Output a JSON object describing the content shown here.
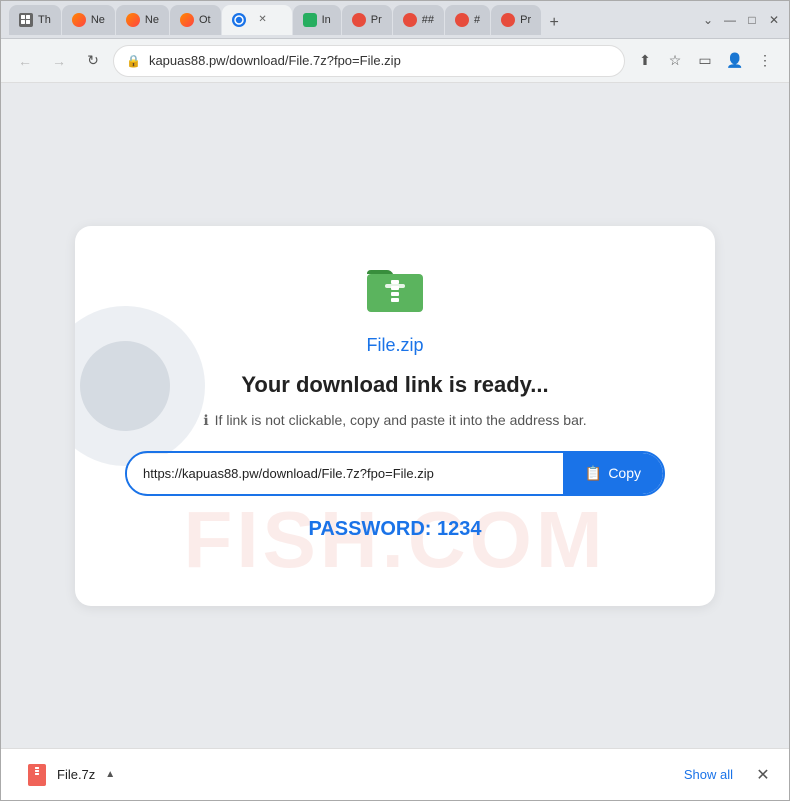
{
  "browser": {
    "tabs": [
      {
        "id": "tab1",
        "label": "Th",
        "active": false
      },
      {
        "id": "tab2",
        "label": "Ne",
        "active": false
      },
      {
        "id": "tab3",
        "label": "Ne",
        "active": false
      },
      {
        "id": "tab4",
        "label": "Ot",
        "active": false
      },
      {
        "id": "tab5",
        "label": "",
        "active": true,
        "url": ""
      },
      {
        "id": "tab6",
        "label": "In",
        "active": false
      },
      {
        "id": "tab7",
        "label": "Pr",
        "active": false
      },
      {
        "id": "tab8",
        "label": "##",
        "active": false
      },
      {
        "id": "tab9",
        "label": "#",
        "active": false
      },
      {
        "id": "tab10",
        "label": "Pr",
        "active": false
      }
    ],
    "address": "kapuas88.pw/download/File.7z?fpo=File.zip",
    "window_controls": {
      "chevron": "˅",
      "minimize": "—",
      "maximize": "□",
      "close": "✕"
    }
  },
  "page": {
    "file_icon_alt": "folder-icon",
    "file_name": "File.zip",
    "download_title": "Your download link is ready...",
    "info_text": "If link is not clickable, copy and paste it into the address bar.",
    "url": "https://kapuas88.pw/download/File.7z?fpo=File.zip",
    "copy_button_label": "Copy",
    "password_label": "PASSWORD: 1234",
    "watermark": "FISH.COM"
  },
  "download_bar": {
    "filename": "File.7z",
    "show_all": "Show all",
    "close_label": "✕"
  }
}
